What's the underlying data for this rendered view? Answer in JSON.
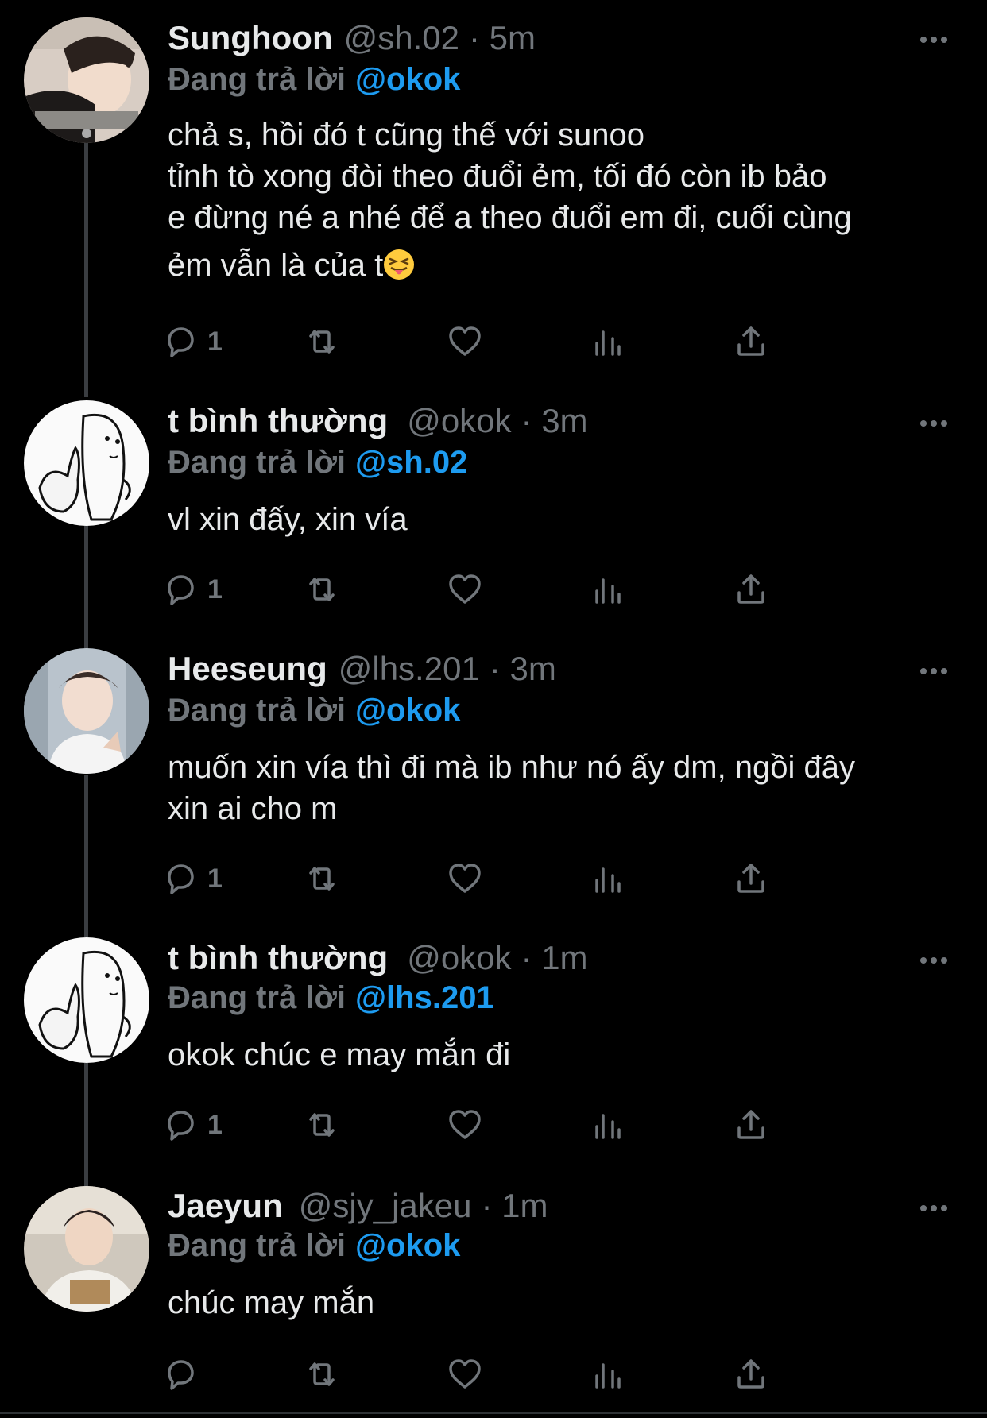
{
  "reply_prefix": "Đang trả lời",
  "tweets": [
    {
      "name": "Sunghoon",
      "handle": "@sh.02",
      "time": "· 5m",
      "reply_to": "@okok",
      "lines": [
        "chả s, hồi đó t cũng thế với sunoo",
        "tỉnh tò xong đòi theo đuổi ẻm, tối đó còn ib bảo",
        "e đừng né a nhé để a theo đuổi em đi, cuối cùng",
        "ẻm vẫn là của t"
      ],
      "emoji": "squinting-tongue-face",
      "reply_count": "1"
    },
    {
      "name": "t bình thường",
      "handle": "@okok",
      "time": "· 3m",
      "reply_to": "@sh.02",
      "lines": [
        "vl xin đấy, xin vía"
      ],
      "reply_count": "1"
    },
    {
      "name": "Heeseung",
      "handle": "@lhs.201",
      "time": "· 3m",
      "reply_to": "@okok",
      "lines": [
        "muốn xin vía thì đi mà ib như nó ấy dm, ngồi đây",
        "xin ai cho m"
      ],
      "reply_count": "1"
    },
    {
      "name": "t bình thường",
      "handle": "@okok",
      "time": "· 1m",
      "reply_to": "@lhs.201",
      "lines": [
        "okok chúc e may mắn đi"
      ],
      "reply_count": "1"
    },
    {
      "name": "Jaeyun",
      "handle": "@sjy_jakeu",
      "time": "· 1m",
      "reply_to": "@okok",
      "lines": [
        "chúc may mắn"
      ],
      "reply_count": ""
    }
  ],
  "colors": {
    "background": "#000000",
    "text": "#e7e9ea",
    "muted": "#71767b",
    "link": "#1d9bf0",
    "thread_line": "#3a3d41"
  },
  "icons": [
    "reply-icon",
    "retweet-icon",
    "like-icon",
    "views-icon",
    "share-icon",
    "more-icon"
  ]
}
